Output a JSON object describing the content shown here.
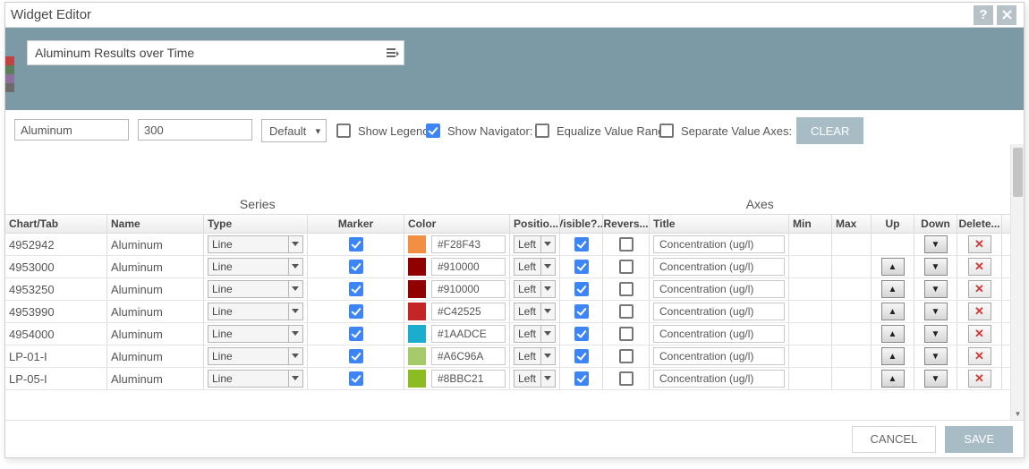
{
  "window": {
    "title": "Widget Editor"
  },
  "banner": {
    "title": "Aluminum Results over Time",
    "side_swatches": [
      "#c24141",
      "#5b7d5b",
      "#8d6f9e",
      "#6b6b6b"
    ]
  },
  "controls": {
    "text_input": "Aluminum",
    "number_input": "300",
    "scale_select": "Default",
    "show_legend": {
      "label": "Show Legend:",
      "checked": false
    },
    "show_navigator": {
      "label": "Show Navigator:",
      "checked": true
    },
    "equalize": {
      "label": "Equalize Value Range:",
      "checked": false
    },
    "separate_axes": {
      "label": "Separate Value Axes:",
      "checked": false
    },
    "clear_label": "CLEAR"
  },
  "grid": {
    "super_headers": {
      "series": "Series",
      "axes": "Axes"
    },
    "headers": {
      "chart": "Chart/Tab",
      "name": "Name",
      "type": "Type",
      "marker": "Marker",
      "color": "Color",
      "position": "Positio...",
      "visible": "Visible?...",
      "reverse": "Revers...",
      "title": "Title",
      "min": "Min",
      "max": "Max",
      "up": "Up",
      "down": "Down",
      "delete": "Delete..."
    },
    "rows": [
      {
        "chart": "4952942",
        "name": "Aluminum",
        "type": "Line",
        "marker": true,
        "color": "#F28F43",
        "position": "Left",
        "visible": true,
        "reverse": false,
        "title": "Concentration (ug/l)",
        "min": "",
        "max": "",
        "show_up": false
      },
      {
        "chart": "4953000",
        "name": "Aluminum",
        "type": "Line",
        "marker": true,
        "color": "#910000",
        "position": "Left",
        "visible": true,
        "reverse": false,
        "title": "Concentration (ug/l)",
        "min": "",
        "max": "",
        "show_up": true
      },
      {
        "chart": "4953250",
        "name": "Aluminum",
        "type": "Line",
        "marker": true,
        "color": "#910000",
        "position": "Left",
        "visible": true,
        "reverse": false,
        "title": "Concentration (ug/l)",
        "min": "",
        "max": "",
        "show_up": true
      },
      {
        "chart": "4953990",
        "name": "Aluminum",
        "type": "Line",
        "marker": true,
        "color": "#C42525",
        "position": "Left",
        "visible": true,
        "reverse": false,
        "title": "Concentration (ug/l)",
        "min": "",
        "max": "",
        "show_up": true
      },
      {
        "chart": "4954000",
        "name": "Aluminum",
        "type": "Line",
        "marker": true,
        "color": "#1AADCE",
        "position": "Left",
        "visible": true,
        "reverse": false,
        "title": "Concentration (ug/l)",
        "min": "",
        "max": "",
        "show_up": true
      },
      {
        "chart": "LP-01-I",
        "name": "Aluminum",
        "type": "Line",
        "marker": true,
        "color": "#A6C96A",
        "position": "Left",
        "visible": true,
        "reverse": false,
        "title": "Concentration (ug/l)",
        "min": "",
        "max": "",
        "show_up": true
      },
      {
        "chart": "LP-05-I",
        "name": "Aluminum",
        "type": "Line",
        "marker": true,
        "color": "#8BBC21",
        "position": "Left",
        "visible": true,
        "reverse": false,
        "title": "Concentration (ug/l)",
        "min": "",
        "max": "",
        "show_up": true
      }
    ]
  },
  "footer": {
    "cancel": "CANCEL",
    "save": "SAVE"
  }
}
